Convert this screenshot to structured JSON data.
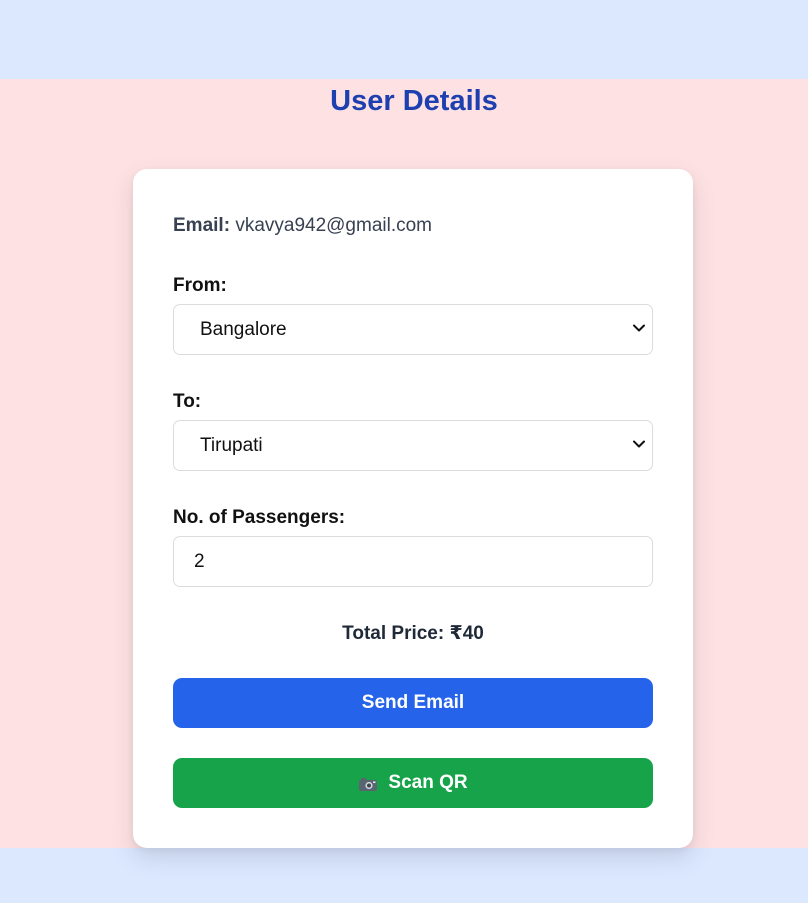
{
  "page": {
    "title": "User Details"
  },
  "user": {
    "email_label": "Email:",
    "email_value": "vkavya942@gmail.com"
  },
  "form": {
    "from_label": "From:",
    "from_value": "Bangalore",
    "to_label": "To:",
    "to_value": "Tirupati",
    "passengers_label": "No. of Passengers:",
    "passengers_value": "2"
  },
  "summary": {
    "total_price": "Total Price: ₹40"
  },
  "actions": {
    "send_email_label": "Send Email",
    "scan_qr_label": "Scan QR",
    "scan_qr_icon": "camera-icon"
  },
  "colors": {
    "page_background": "#dbe8fe",
    "band_background": "#fee1e2",
    "title_color": "#1e3faf",
    "send_button": "#2563ea",
    "scan_button": "#16a34a"
  }
}
